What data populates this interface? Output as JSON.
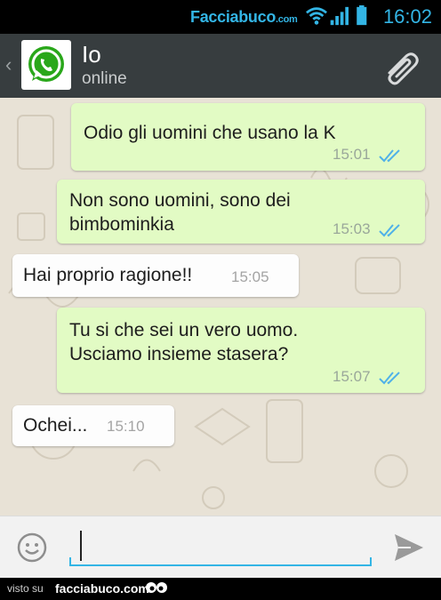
{
  "status_bar": {
    "site_name": "Facciabuco",
    "site_tld": ".com",
    "time": "16:02",
    "icons": [
      "wifi-icon",
      "signal-icon",
      "battery-icon"
    ]
  },
  "header": {
    "back_glyph": "‹",
    "contact_name": "Io",
    "contact_status": "online",
    "avatar_icon": "whatsapp-logo-icon",
    "attach_icon": "paperclip-icon"
  },
  "messages": [
    {
      "direction": "out",
      "text": "Odio gli uomini che usano la K",
      "time": "15:01",
      "read": true
    },
    {
      "direction": "out",
      "text": "Non sono uomini, sono dei bimbominkia",
      "time": "15:03",
      "read": true
    },
    {
      "direction": "in",
      "text": "Hai proprio ragione!!",
      "time": "15:05"
    },
    {
      "direction": "out",
      "text": "Tu si che sei un vero uomo. Usciamo insieme stasera?",
      "time": "15:07",
      "read": true
    },
    {
      "direction": "in",
      "text": "Ochei...",
      "time": "15:10"
    }
  ],
  "input_bar": {
    "value": "",
    "emoji_icon": "smiley-icon",
    "send_icon": "send-icon"
  },
  "footer": {
    "label": "visto su",
    "site": "facciabuco.com"
  },
  "colors": {
    "accent": "#33b5e5",
    "header_bg": "#373d3f",
    "outgoing_bubble": "#e2fbc4",
    "incoming_bubble": "#fdfdfd",
    "read_ticks": "#4fb1e8"
  }
}
